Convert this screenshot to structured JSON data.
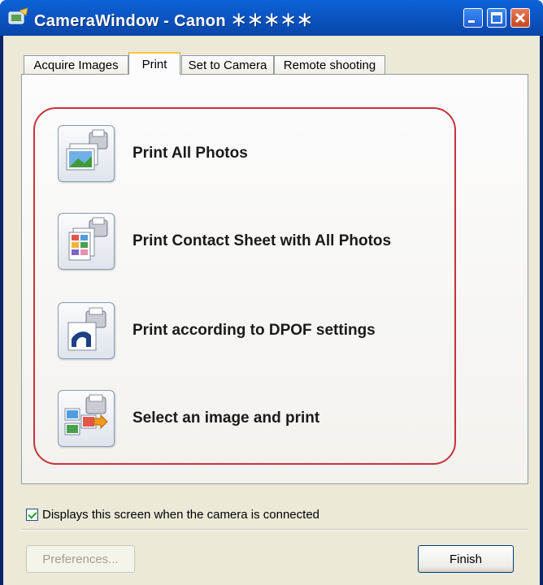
{
  "window": {
    "title": "CameraWindow - Canon ＊＊＊＊＊"
  },
  "tabs": [
    {
      "label": "Acquire Images",
      "active": false
    },
    {
      "label": "Print",
      "active": true
    },
    {
      "label": "Set to Camera",
      "active": false
    },
    {
      "label": "Remote shooting",
      "active": false
    }
  ],
  "actions": [
    {
      "label": "Print All Photos",
      "icon": "print-all-photos-icon"
    },
    {
      "label": "Print Contact Sheet with All Photos",
      "icon": "contact-sheet-icon"
    },
    {
      "label": "Print according to DPOF settings",
      "icon": "dpof-print-icon"
    },
    {
      "label": "Select an image and print",
      "icon": "select-image-print-icon"
    }
  ],
  "options": {
    "show_on_connect_label": "Displays this screen when the camera is connected",
    "show_on_connect_checked": true
  },
  "footer": {
    "preferences_label": "Preferences...",
    "finish_label": "Finish"
  },
  "colors": {
    "highlight_border": "#c8323a",
    "titlebar": "#0b55c4",
    "window_bg": "#ece9d8"
  }
}
